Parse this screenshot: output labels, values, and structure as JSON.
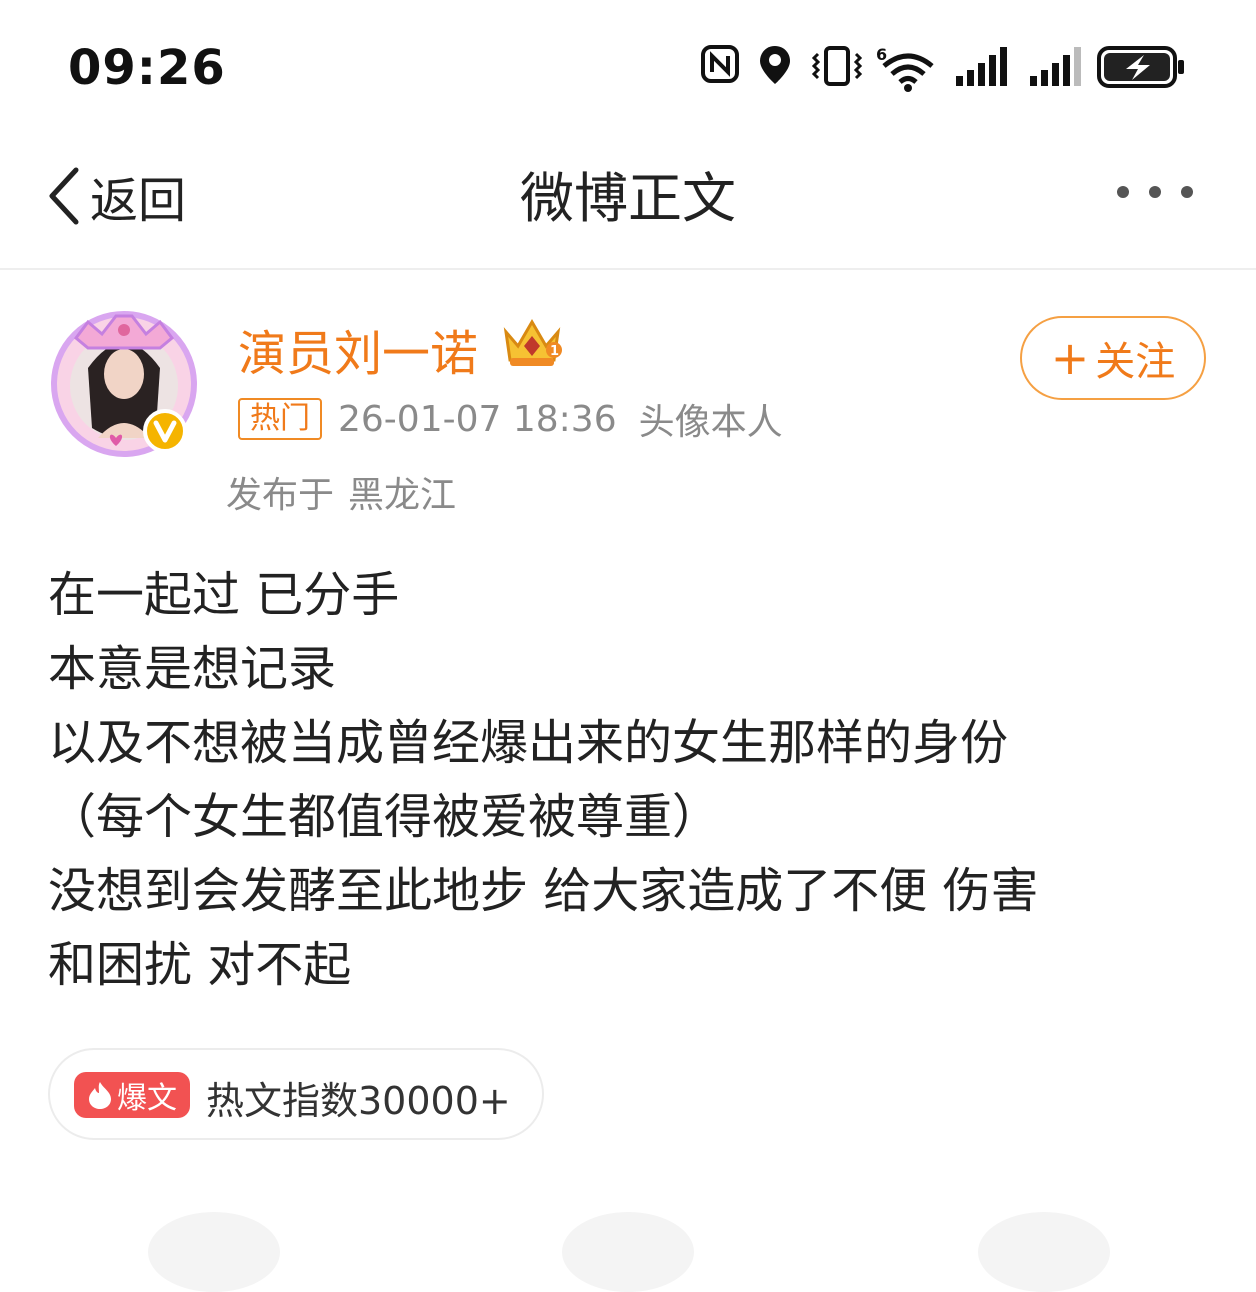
{
  "status_bar": {
    "time": "09:26",
    "icons": [
      "nfc-icon",
      "location-icon",
      "vibrate-icon",
      "wifi-6-icon",
      "signal-icon",
      "signal-icon",
      "battery-charging-icon"
    ]
  },
  "nav": {
    "back_label": "返回",
    "title": "微博正文",
    "more_icon": "more-dots-icon"
  },
  "post": {
    "author": "演员刘一诺",
    "follow_label": "关注",
    "hot_tag": "热门",
    "timestamp": "26-01-07 18:36",
    "source": "头像本人",
    "location_prefix": "发布于",
    "location": "黑龙江",
    "lines": [
      "在一起过 已分手",
      "本意是想记录",
      "以及不想被当成曾经爆出来的女生那样的身份",
      "（每个女生都值得被爱被尊重）",
      "没想到会发酵至此地步 给大家造成了不便 伤害",
      "和困扰 对不起"
    ]
  },
  "hot_index": {
    "badge": "爆文",
    "text": "热文指数30000+"
  },
  "colors": {
    "accent": "#f07a1a",
    "badge_red": "#f25252",
    "verified_gold": "#f5b400",
    "meta_gray": "#8a8a8a"
  }
}
